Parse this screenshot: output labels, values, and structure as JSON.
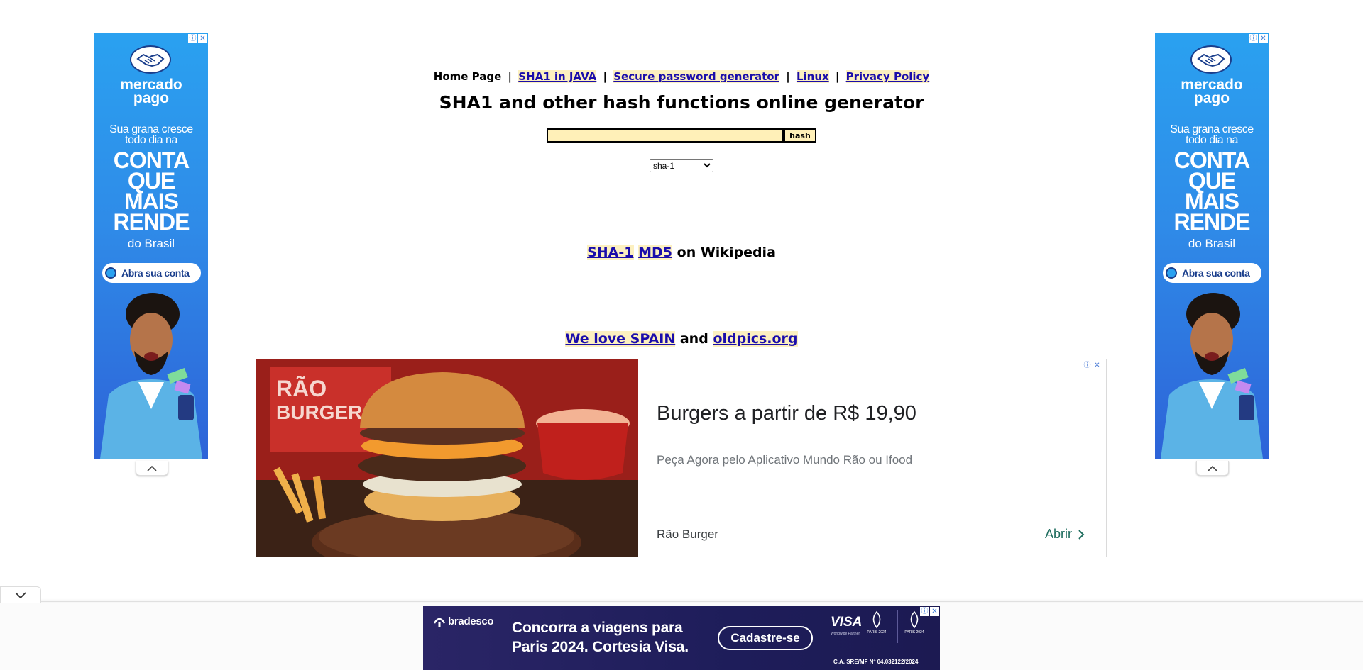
{
  "nav": {
    "home": "Home Page",
    "links": [
      "SHA1 in JAVA",
      "Secure password generator",
      "Linux",
      "Privacy Policy"
    ],
    "separator": "|"
  },
  "title": "SHA1 and other hash functions online generator",
  "hash_input": {
    "value": "",
    "placeholder": ""
  },
  "hash_button": "hash",
  "algorithm_select": {
    "selected": "sha-1"
  },
  "wiki": {
    "link1": "SHA-1",
    "link2": "MD5",
    "suffix": "on Wikipedia"
  },
  "love": {
    "link1": "We love SPAIN",
    "joiner": "and",
    "link2": "oldpics.org"
  },
  "side_ad": {
    "brand": "mercado pago",
    "brand_line1": "mercado",
    "brand_line2": "pago",
    "tagline_line1": "Sua grana cresce",
    "tagline_line2": "todo dia na",
    "headline": [
      "CONTA",
      "QUE",
      "MAIS",
      "RENDE"
    ],
    "sub": "do Brasil",
    "cta": "Abra sua conta",
    "accent": "#2aa1f0"
  },
  "burger_ad": {
    "image_text_1": "RÃO",
    "image_text_2": "BURGER",
    "headline": "Burgers a partir de R$ 19,90",
    "description": "Peça Agora pelo Aplicativo Mundo Rão ou Ifood",
    "advertiser": "Rão Burger",
    "cta": "Abrir",
    "cta_color": "#1e6d5e"
  },
  "bottom_ad": {
    "logo": "bradesco",
    "message_line1": "Concorra a viagens para",
    "message_line2": "Paris 2024. Cortesia Visa.",
    "cta": "Cadastre-se",
    "visa": "VISA",
    "visa_sub": "Worldwide Partner",
    "paris": "PARIS 2024",
    "legal": "C.A. SRE/MF Nº 04.032122/2024",
    "bg": "#1e1d5a"
  },
  "ad_controls": {
    "info": "ⓘ",
    "close": "✕"
  }
}
